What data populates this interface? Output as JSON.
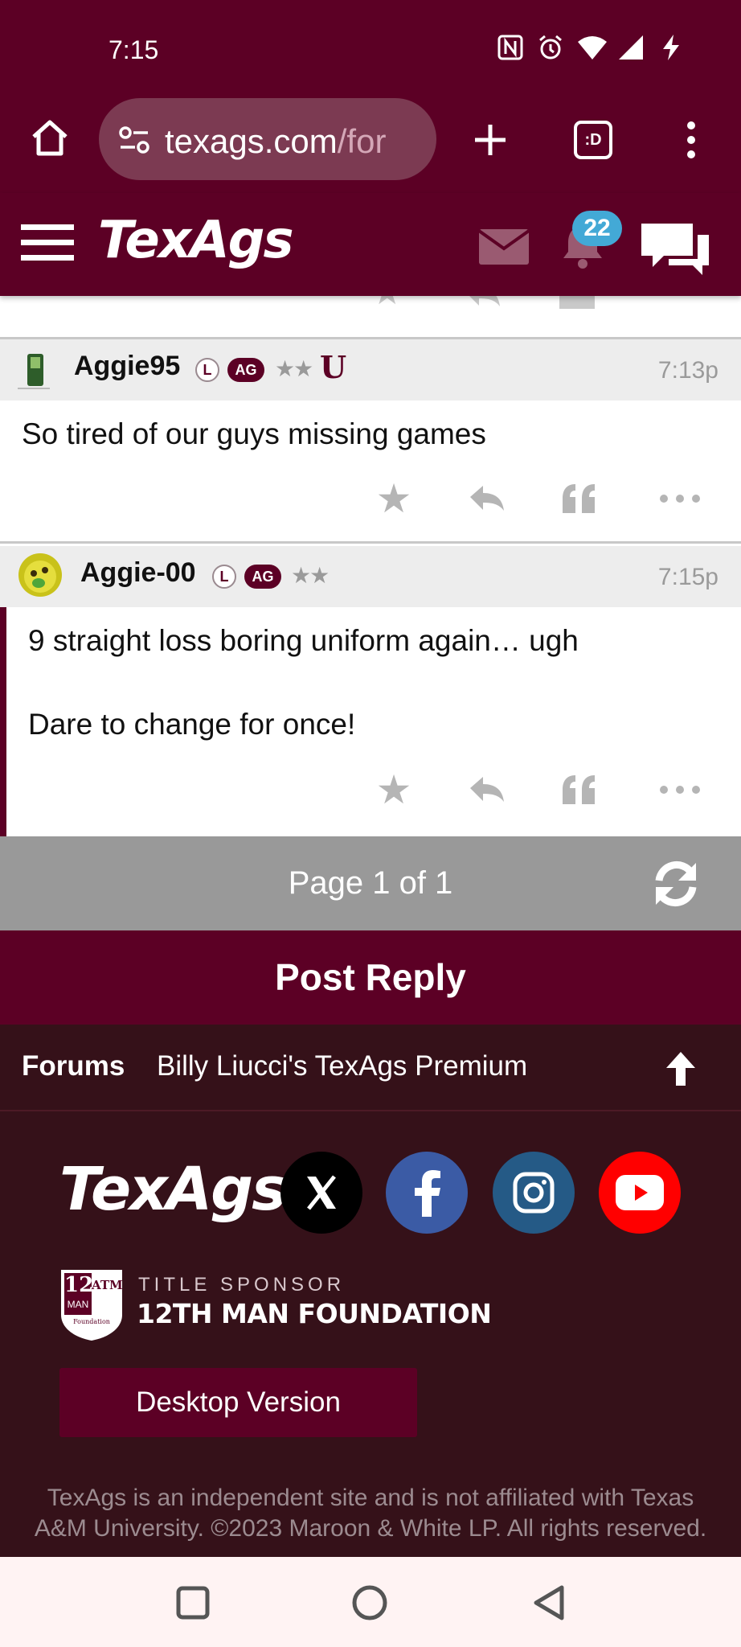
{
  "status_bar": {
    "time": "7:15"
  },
  "browser": {
    "url_visible": "texags.com/for",
    "url_highlight": "texags.com",
    "url_faded": "/for",
    "tab_count": ":D"
  },
  "header": {
    "logo": "TexAgs",
    "notification_count": "22"
  },
  "posts": [
    {
      "username": "Aggie95",
      "badge_l": "L",
      "badge_ag": "AG",
      "stars": "★★",
      "extra_badge": "U",
      "time": "7:13p",
      "body_lines": [
        "So tired of our guys missing games"
      ]
    },
    {
      "username": "Aggie-00",
      "badge_l": "L",
      "badge_ag": "AG",
      "stars": "★★",
      "time": "7:15p",
      "body_lines": [
        "9 straight loss boring uniform again… ugh",
        "Dare to change for once!"
      ]
    }
  ],
  "pager": {
    "label": "Page 1 of 1"
  },
  "post_reply": {
    "label": "Post Reply"
  },
  "footer": {
    "breadcrumb_root": "Forums",
    "breadcrumb_current": "Billy Liucci's TexAgs Premium",
    "logo": "TexAgs",
    "sponsor_label": "TITLE SPONSOR",
    "sponsor_name": "12TH MAN FOUNDATION",
    "sponsor_logo_top": "12",
    "sponsor_logo_mid": "MAN",
    "sponsor_logo_tam": "ATM",
    "sponsor_logo_foundation": "Foundation",
    "desktop_button": "Desktop Version",
    "disclaimer": "TexAgs is an independent site and is not affiliated with Texas A&M University. ©2023 Maroon & White LP. All rights reserved."
  },
  "colors": {
    "maroon": "#5c0025",
    "footer_bg": "#351119",
    "pager_bg": "#999999",
    "badge_blue": "#43a9d6",
    "facebook": "#3b5ba5",
    "instagram": "#255a86",
    "youtube": "#ff0000"
  }
}
